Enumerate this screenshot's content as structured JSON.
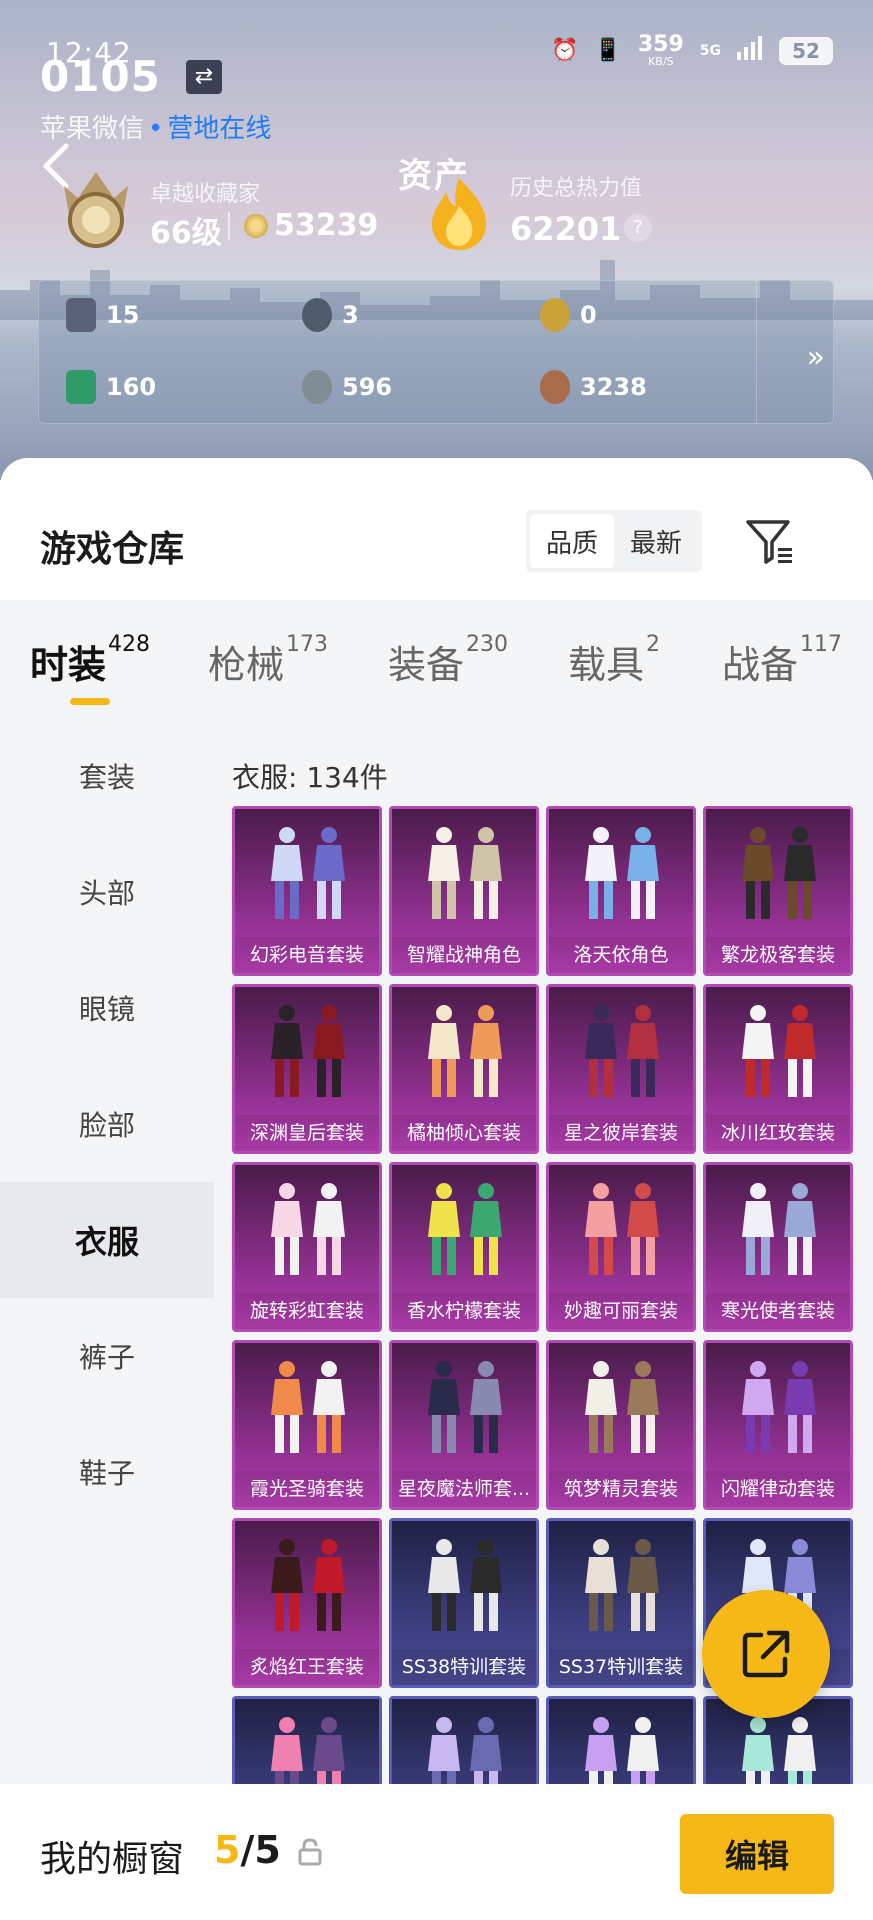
{
  "status_bar": {
    "time": "12:42",
    "speed_value": "359",
    "speed_unit": "KB/S",
    "network": "5G",
    "battery": "52"
  },
  "account": {
    "id": "0105",
    "platform": "苹果微信",
    "presence": "营地在线"
  },
  "header": {
    "title": "资产"
  },
  "rank": {
    "title": "卓越收藏家",
    "level": "66级",
    "points": "53239"
  },
  "heat": {
    "label": "历史总热力值",
    "value": "62201",
    "help": "?"
  },
  "currencies": [
    {
      "value": "15",
      "icon": "card-currency-icon",
      "color": "#6a7184"
    },
    {
      "value": "3",
      "icon": "s-coin-icon",
      "color": "#5a6a7a"
    },
    {
      "value": "0",
      "icon": "gold-coin-icon",
      "color": "#c9a23a"
    },
    {
      "value": "160",
      "icon": "green-ticket-icon",
      "color": "#2f9b6a"
    },
    {
      "value": "596",
      "icon": "silver-coin-icon",
      "color": "#8a9aa0"
    },
    {
      "value": "3238",
      "icon": "bronze-coin-icon",
      "color": "#a86c4a"
    }
  ],
  "warehouse": {
    "title": "游戏仓库",
    "sort": {
      "quality": "品质",
      "newest": "最新"
    },
    "tabs": [
      {
        "label": "时装",
        "count": "428"
      },
      {
        "label": "枪械",
        "count": "173"
      },
      {
        "label": "装备",
        "count": "230"
      },
      {
        "label": "载具",
        "count": "2"
      },
      {
        "label": "战备",
        "count": "117"
      }
    ],
    "categories": [
      "套装",
      "头部",
      "眼镜",
      "脸部",
      "衣服",
      "裤子",
      "鞋子"
    ],
    "active_category": "衣服",
    "count_line": "衣服: 134件",
    "items": [
      {
        "name": "幻彩电音套装",
        "style": "purple"
      },
      {
        "name": "智耀战神角色",
        "style": "purple"
      },
      {
        "name": "洛天依角色",
        "style": "purple"
      },
      {
        "name": "繁龙极客套装",
        "style": "purple"
      },
      {
        "name": "深渊皇后套装",
        "style": "purple"
      },
      {
        "name": "橘柚倾心套装",
        "style": "purple"
      },
      {
        "name": "星之彼岸套装",
        "style": "purple"
      },
      {
        "name": "冰川红玫套装",
        "style": "purple"
      },
      {
        "name": "旋转彩虹套装",
        "style": "purple"
      },
      {
        "name": "香水柠檬套装",
        "style": "purple"
      },
      {
        "name": "妙趣可丽套装",
        "style": "purple"
      },
      {
        "name": "寒光使者套装",
        "style": "purple"
      },
      {
        "name": "霞光圣骑套装",
        "style": "purple"
      },
      {
        "name": "星夜魔法师套...",
        "style": "purple"
      },
      {
        "name": "筑梦精灵套装",
        "style": "purple"
      },
      {
        "name": "闪耀律动套装",
        "style": "purple"
      },
      {
        "name": "炙焰红王套装",
        "style": "purple"
      },
      {
        "name": "SS38特训套装",
        "style": "blue"
      },
      {
        "name": "SS37特训套装",
        "style": "blue"
      },
      {
        "name": "",
        "style": "blue"
      },
      {
        "name": "",
        "style": "blue"
      },
      {
        "name": "",
        "style": "blue"
      },
      {
        "name": "",
        "style": "blue"
      },
      {
        "name": "",
        "style": "blue"
      }
    ]
  },
  "showcase": {
    "label": "我的橱窗",
    "current": "5",
    "total": "/5",
    "edit_label": "编辑"
  }
}
